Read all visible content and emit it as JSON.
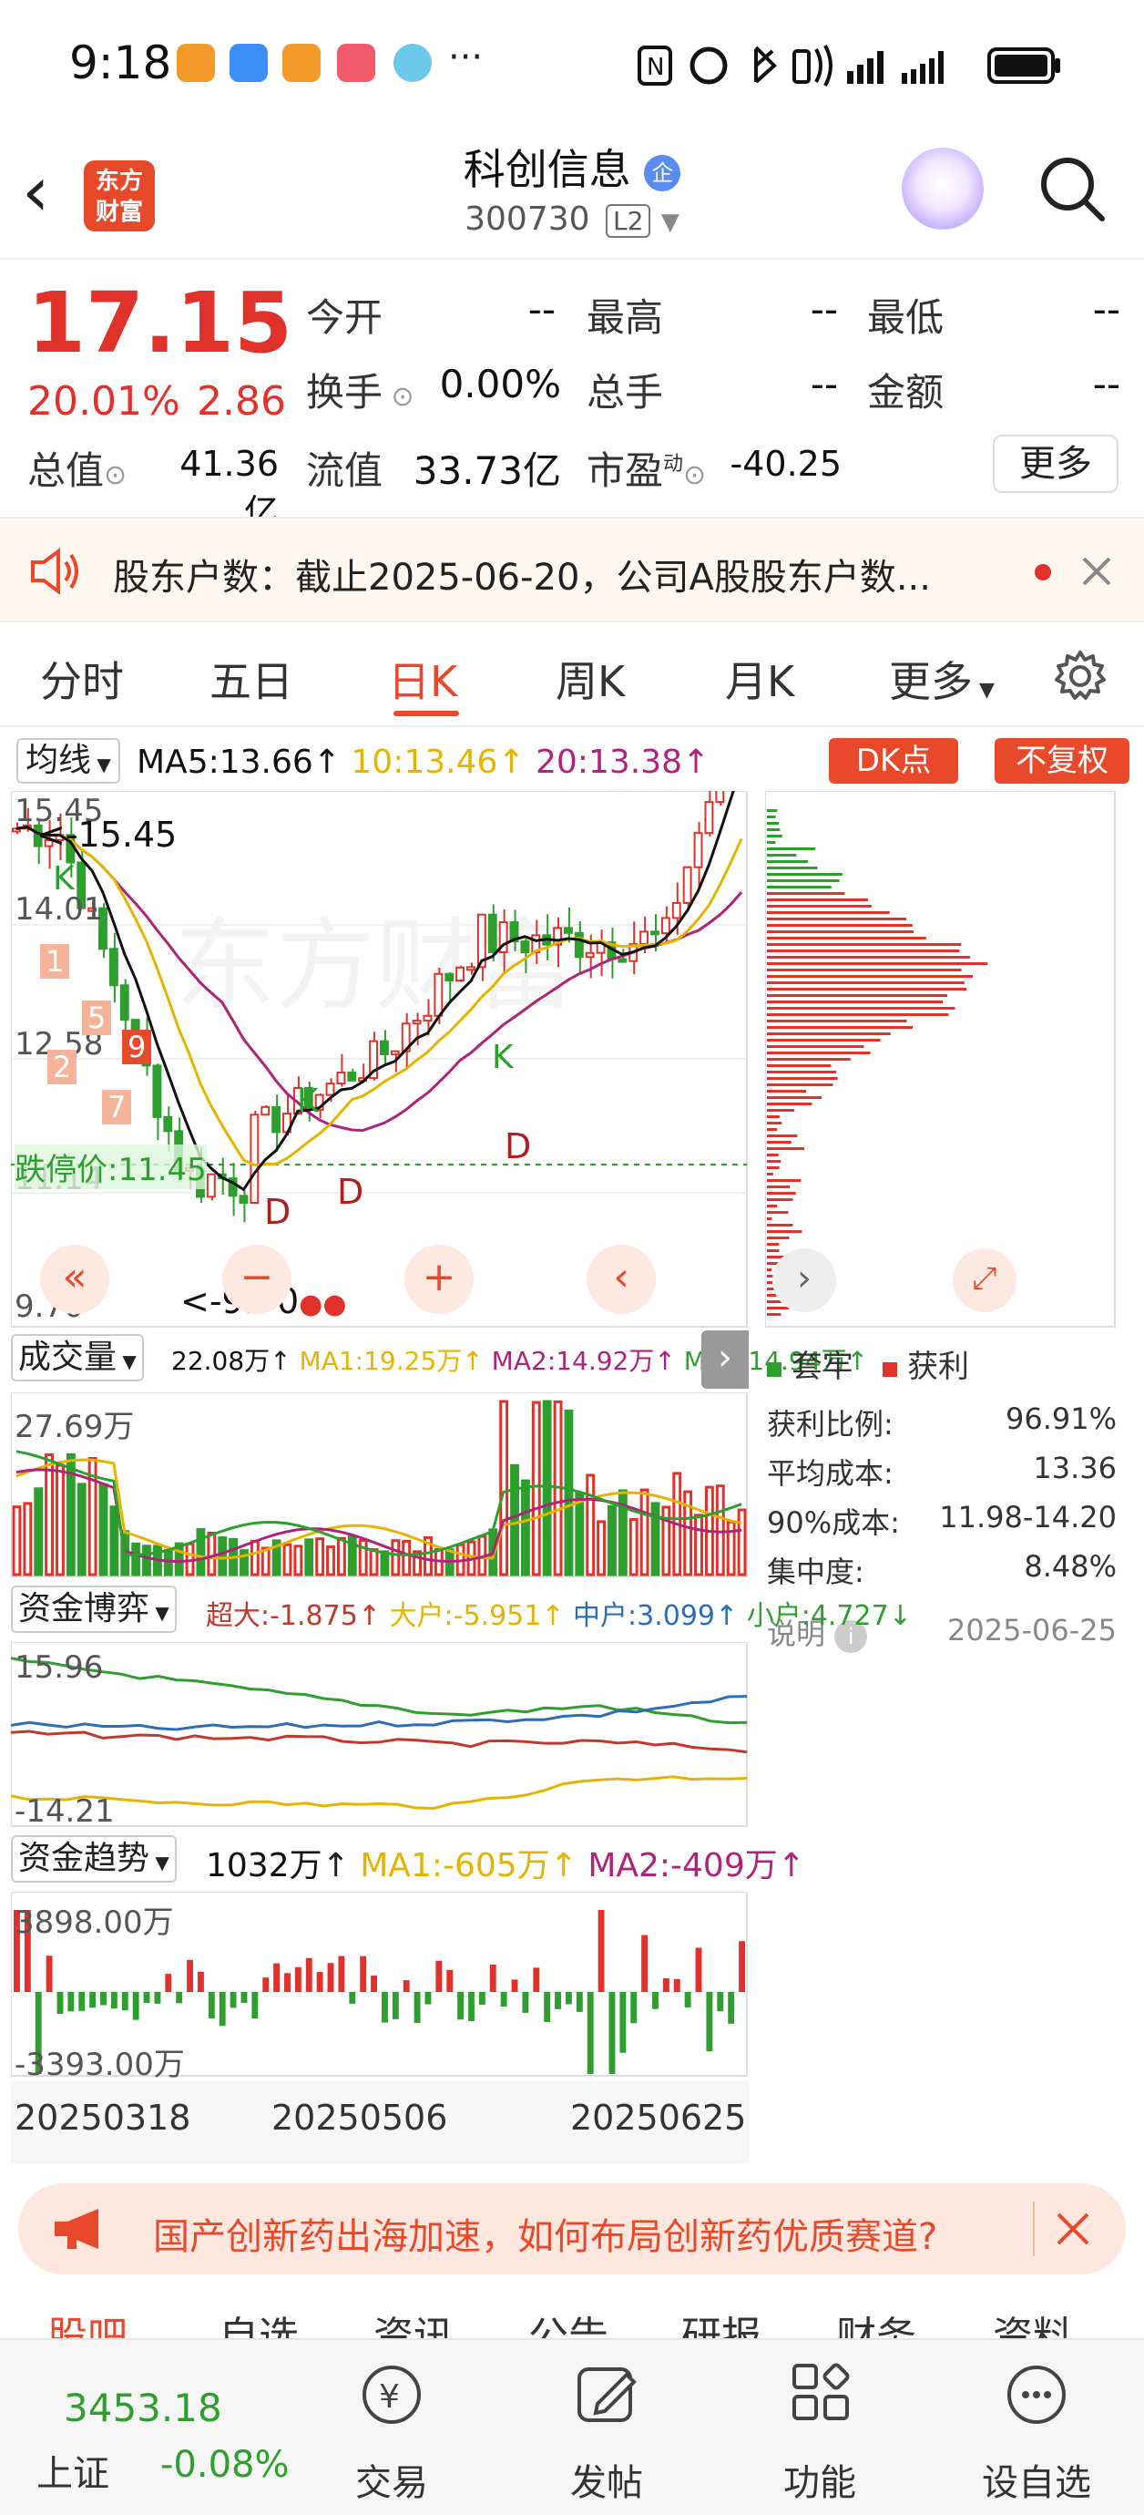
{
  "status_bar": {
    "time": "9:18",
    "more": "···"
  },
  "header": {
    "logo_line1": "东方",
    "logo_line2": "财富",
    "stock_name": "科创信息",
    "badge": "企",
    "stock_code": "300730",
    "level": "L2"
  },
  "quote": {
    "price": "17.15",
    "change_pct": "20.01%",
    "change_abs": "2.86",
    "labels": {
      "open": "今开",
      "high": "最高",
      "low": "最低",
      "turnover": "换手",
      "volume": "总手",
      "amount": "金额",
      "total_value": "总值",
      "float_value": "流值",
      "pe": "市盈",
      "pe_sup": "动"
    },
    "values": {
      "open": "--",
      "high": "--",
      "low": "--",
      "turnover": "0.00%",
      "volume": "--",
      "amount": "--",
      "total_value": "41.36亿",
      "float_value": "33.73亿",
      "pe": "-40.25"
    },
    "more_label": "更多"
  },
  "notice": {
    "text": "股东户数：截止2025-06-20，公司A股股东户数..."
  },
  "tabs": [
    "分时",
    "五日",
    "日K",
    "周K",
    "月K",
    "更多"
  ],
  "kline": {
    "indicator_label": "均线",
    "ma5": "MA5:13.66",
    "ma10": "10:13.46",
    "ma20": "20:13.38",
    "dk_label": "DK点",
    "adj_label": "不复权",
    "y_max": "15.45",
    "y_high_mark": "<-15.45",
    "y_mid1": "14.01",
    "y_mid2": "12.58",
    "y_mid3": "11.14",
    "y_min": "9.70",
    "low_mark": "<-9.70",
    "limit_down_label": "跌停价:11.45",
    "k_marker": "K",
    "d_marker": "D",
    "num_markers": [
      "1",
      "5",
      "2",
      "7",
      "9"
    ]
  },
  "chip": {
    "legend_trapped": "套牢",
    "legend_profit": "获利",
    "rows": [
      {
        "label": "获利比例:",
        "value": "96.91%"
      },
      {
        "label": "平均成本:",
        "value": "13.36"
      },
      {
        "label": "90%成本:",
        "value": "11.98-14.20"
      },
      {
        "label": "集中度:",
        "value": "8.48%"
      }
    ],
    "note_label": "说明",
    "date": "2025-06-25"
  },
  "volume": {
    "label": "成交量",
    "cur": "22.08万",
    "ma1": "MA1:19.25万",
    "ma2": "MA2:14.92万",
    "ma3": "MA3:14.94万",
    "y_max": "27.69万"
  },
  "fund_game": {
    "label": "资金博弈",
    "super": "超大:-1.875",
    "large": "大户:-5.951",
    "mid": "中户:3.099",
    "small": "小户:4.727",
    "y_max": "15.96",
    "y_min": "-14.21"
  },
  "fund_trend": {
    "label": "资金趋势",
    "cur": "1032万",
    "ma1": "MA1:-605万",
    "ma2": "MA2:-409万",
    "y_max": "3898.00万",
    "y_min": "-3393.00万"
  },
  "x_axis": [
    "20250318",
    "20250506",
    "20250625"
  ],
  "banner": {
    "text": "国产创新药出海加速，如何布局创新药优质赛道?"
  },
  "subtabs": [
    "股吧",
    "自选",
    "资讯",
    "公告",
    "研报",
    "财务",
    "资料"
  ],
  "bottom_nav": {
    "index_value": "3453.18",
    "index_name": "上证",
    "index_change": "-0.08%",
    "items": [
      "交易",
      "发帖",
      "功能",
      "设自选"
    ]
  },
  "colors": {
    "up": "#e0312a",
    "down": "#2e9e2e",
    "accent": "#e8492a",
    "ma5": "#111111",
    "ma10": "#e6b400",
    "ma20": "#b0237a"
  }
}
